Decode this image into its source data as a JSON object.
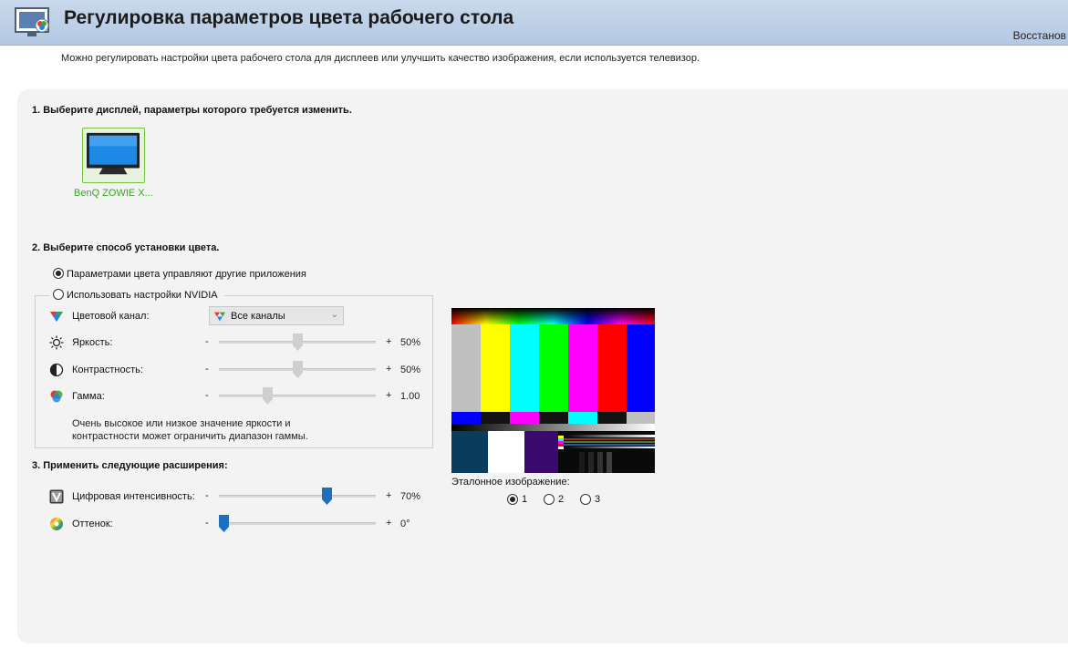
{
  "header": {
    "title": "Регулировка параметров цвета рабочего стола",
    "restore_label": "Восстанов"
  },
  "description": "Можно регулировать настройки цвета рабочего стола для дисплеев или улучшить качество изображения, если используется телевизор.",
  "section1": {
    "heading": "1. Выберите дисплей, параметры которого требуется изменить.",
    "display_name": "BenQ ZOWIE X..."
  },
  "section2": {
    "heading": "2. Выберите способ установки цвета.",
    "option_other_apps": "Параметрами цвета управляют другие приложения",
    "option_other_apps_selected": true,
    "option_nvidia": "Использовать настройки NVIDIA",
    "option_nvidia_selected": false,
    "channel_label": "Цветовой канал:",
    "channel_value": "Все каналы",
    "brightness": {
      "label": "Яркость:",
      "value_text": "50%",
      "fraction": 0.5
    },
    "contrast": {
      "label": "Контрастность:",
      "value_text": "50%",
      "fraction": 0.5
    },
    "gamma": {
      "label": "Гамма:",
      "value_text": "1.00",
      "fraction": 0.3
    },
    "note": "Очень высокое или низкое значение яркости и контрастности может ограничить диапазон гаммы.",
    "minus": "-",
    "plus": "+"
  },
  "section3": {
    "heading": "3. Применить следующие расширения:",
    "vibrance": {
      "label": "Цифровая интенсивность:",
      "value_text": "70%",
      "fraction": 0.7
    },
    "hue": {
      "label": "Оттенок:",
      "value_text": "0°",
      "fraction": 0.0
    }
  },
  "reference": {
    "label": "Эталонное изображение:",
    "options": [
      "1",
      "2",
      "3"
    ],
    "selected": "1"
  },
  "colors": {
    "accent_green": "#76b900",
    "display_green_text": "#3aa628",
    "slider_blue": "#1f6fc0",
    "slider_gray": "#cfcfcf"
  }
}
